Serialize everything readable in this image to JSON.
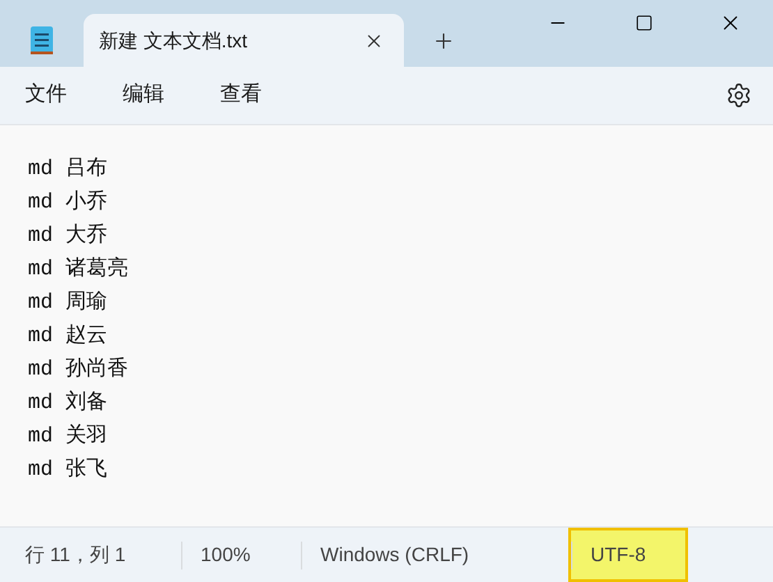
{
  "tabs": [
    {
      "label": "新建 文本文档.txt",
      "selected": true
    }
  ],
  "menu": [
    "文件",
    "编辑",
    "查看"
  ],
  "editor": {
    "lines": [
      "md 吕布",
      "md 小乔",
      "md 大乔",
      "md 诸葛亮",
      "md 周瑜",
      "md 赵云",
      "md 孙尚香",
      "md 刘备",
      "md 关羽",
      "md 张飞"
    ]
  },
  "status_bar": [
    {
      "text": "行 11，列 1",
      "highlighted": false
    },
    {
      "text": "100%",
      "highlighted": false
    },
    {
      "text": "Windows (CRLF)",
      "highlighted": false
    },
    {
      "text": "UTF-8",
      "highlighted": true
    }
  ]
}
